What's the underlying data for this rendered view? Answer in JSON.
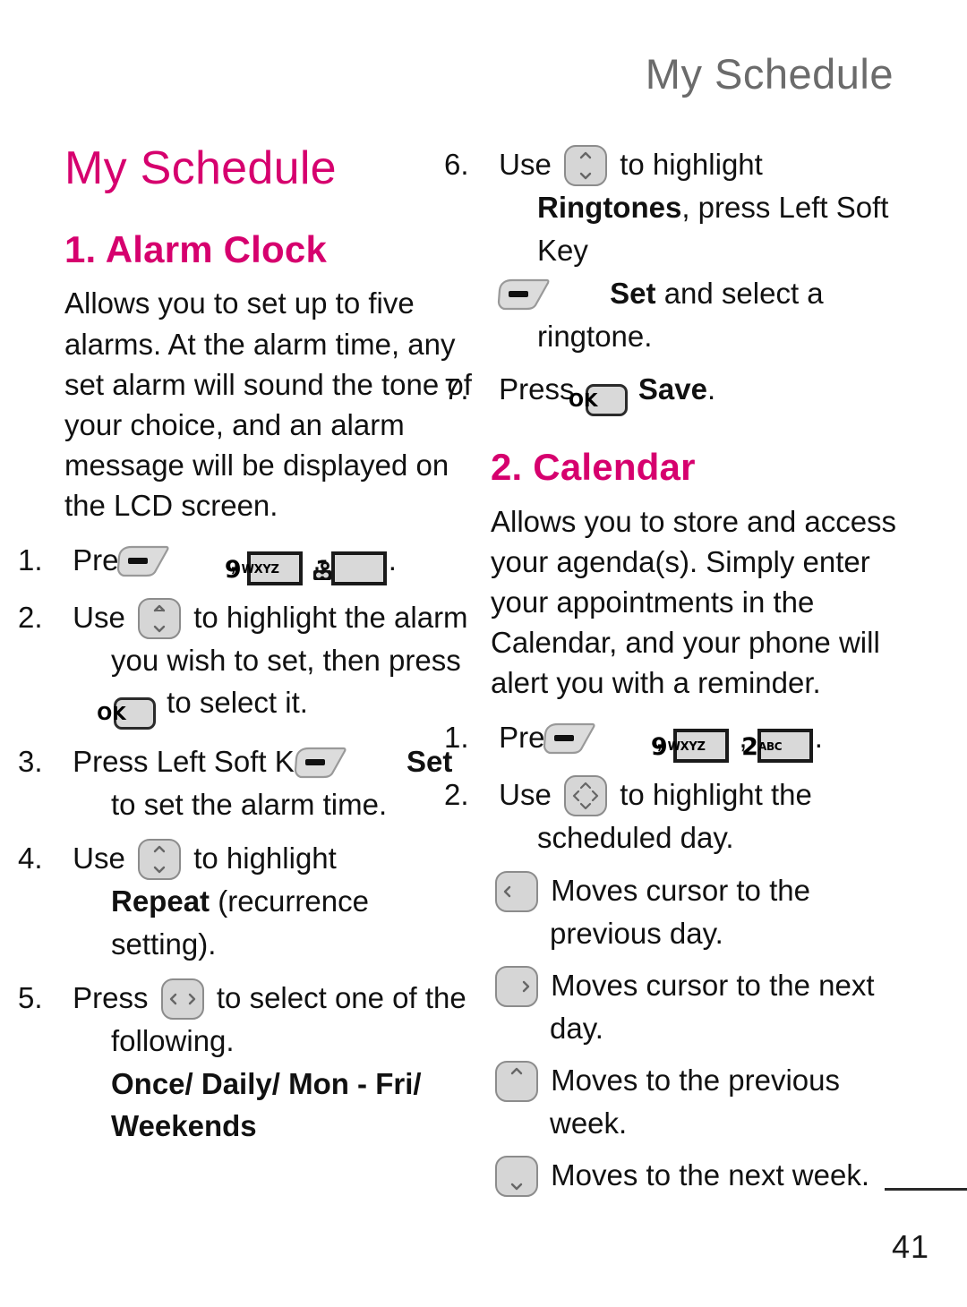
{
  "header": {
    "running_title": "My Schedule",
    "running_title_color": "#6b6b6b"
  },
  "theme": {
    "accent_color": "#d6006e",
    "body_text_color": "#111111",
    "key_fill": "#d9d9d9",
    "key_border": "#1a1a1a"
  },
  "left_column": {
    "chapter_title": "My Schedule",
    "section": {
      "title": "1. Alarm Clock",
      "intro": "Allows you to set up to five alarms. At the alarm time, any set alarm will sound the tone of your choice, and an alarm message will be displayed on the LCD screen.",
      "steps": [
        {
          "num": "1.",
          "text_before": "Press",
          "keys": [
            "left-soft-key",
            "key-9-wxyz",
            "key-1-voicemail"
          ],
          "separator": ",",
          "text_after": "."
        },
        {
          "num": "2.",
          "text_before": "Use",
          "key": "nav-up-down",
          "text_mid": "to highlight the alarm you wish to set, then press",
          "key2": "ok-key",
          "text_after": "to select it."
        },
        {
          "num": "3.",
          "text_before": "Press Left Soft Key",
          "key": "left-soft-key",
          "bold_label": "Set",
          "text_after": "to set the alarm time."
        },
        {
          "num": "4.",
          "text_before": "Use",
          "key": "nav-up-down",
          "text_mid": "to highlight",
          "bold_label": "Repeat",
          "text_after": "(recurrence setting)."
        },
        {
          "num": "5.",
          "text_before": "Press",
          "key": "nav-left-right",
          "text_after": "to select one of the following.",
          "options_bold": "Once/ Daily/ Mon - Fri/ Weekends"
        }
      ]
    }
  },
  "right_column": {
    "alarm_steps_continued": [
      {
        "num": "6.",
        "text_before": "Use",
        "key": "nav-up-down",
        "text_mid": "to highlight",
        "bold_label_1": "Ringtones",
        "text_mid_2": ", press Left Soft Key",
        "key2": "left-soft-key",
        "bold_label_2": "Set",
        "text_after": "and select a ringtone."
      },
      {
        "num": "7.",
        "text_before": "Press",
        "key": "ok-key",
        "bold_label": "Save",
        "text_after": "."
      }
    ],
    "section": {
      "title": "2. Calendar",
      "intro": "Allows you to store and access your agenda(s). Simply enter your appointments in the Calendar, and your phone will alert you with a reminder.",
      "steps": [
        {
          "num": "1.",
          "text_before": "Press",
          "keys": [
            "left-soft-key",
            "key-9-wxyz",
            "key-2-abc"
          ],
          "separator": ",",
          "text_after": "."
        },
        {
          "num": "2.",
          "text_before": "Use",
          "key": "nav-four-way",
          "text_after": "to highlight the scheduled day."
        }
      ],
      "key_descriptions": [
        {
          "key": "nav-left",
          "text": "Moves cursor to the previous day."
        },
        {
          "key": "nav-right",
          "text": "Moves cursor to the next day."
        },
        {
          "key": "nav-up",
          "text": "Moves to the previous week."
        },
        {
          "key": "nav-down",
          "text": "Moves to the next week."
        }
      ]
    }
  },
  "keys": {
    "key_9_digit": "9",
    "key_9_letters": "WXYZ",
    "key_1_digit": "1",
    "key_2_digit": "2",
    "key_2_letters": "ABC",
    "ok_label": "OK"
  },
  "footer": {
    "page_number": "41"
  }
}
